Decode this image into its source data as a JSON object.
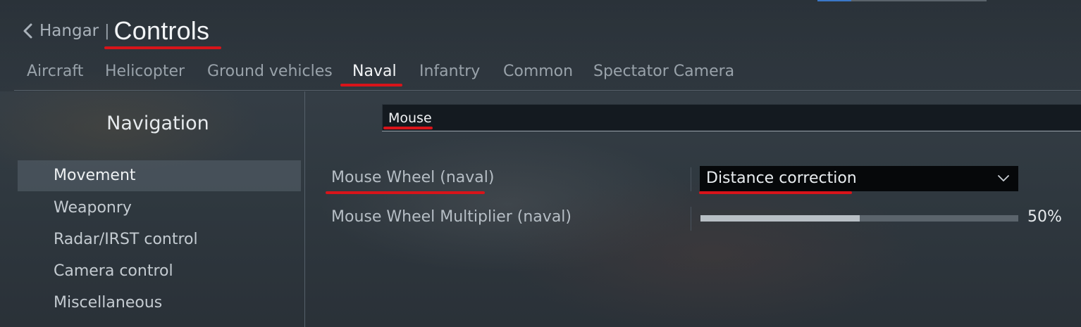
{
  "header": {
    "back_label": "Hangar",
    "separator": "|",
    "title": "Controls"
  },
  "tabs": [
    {
      "label": "Aircraft",
      "active": false
    },
    {
      "label": "Helicopter",
      "active": false
    },
    {
      "label": "Ground vehicles",
      "active": false
    },
    {
      "label": "Naval",
      "active": true
    },
    {
      "label": "Infantry",
      "active": false
    },
    {
      "label": "Common",
      "active": false
    },
    {
      "label": "Spectator Camera",
      "active": false
    }
  ],
  "navigation": {
    "title": "Navigation",
    "items": [
      {
        "label": "Movement",
        "active": true
      },
      {
        "label": "Weaponry",
        "active": false
      },
      {
        "label": "Radar/IRST control",
        "active": false
      },
      {
        "label": "Camera control",
        "active": false
      },
      {
        "label": "Miscellaneous",
        "active": false
      }
    ]
  },
  "search": {
    "value": "Mouse"
  },
  "settings": {
    "mouse_wheel": {
      "label": "Mouse Wheel (naval)",
      "value": "Distance correction"
    },
    "mouse_wheel_multiplier": {
      "label": "Mouse Wheel Multiplier (naval)",
      "value_text": "50%",
      "fill_fraction": 0.5
    }
  },
  "colors": {
    "highlight_underline": "#d8141a",
    "active_text": "#f3f5f7",
    "inactive_text": "#99a2aa"
  },
  "icons": {
    "back": "chevron-left-icon",
    "dropdown": "chevron-down-icon"
  }
}
